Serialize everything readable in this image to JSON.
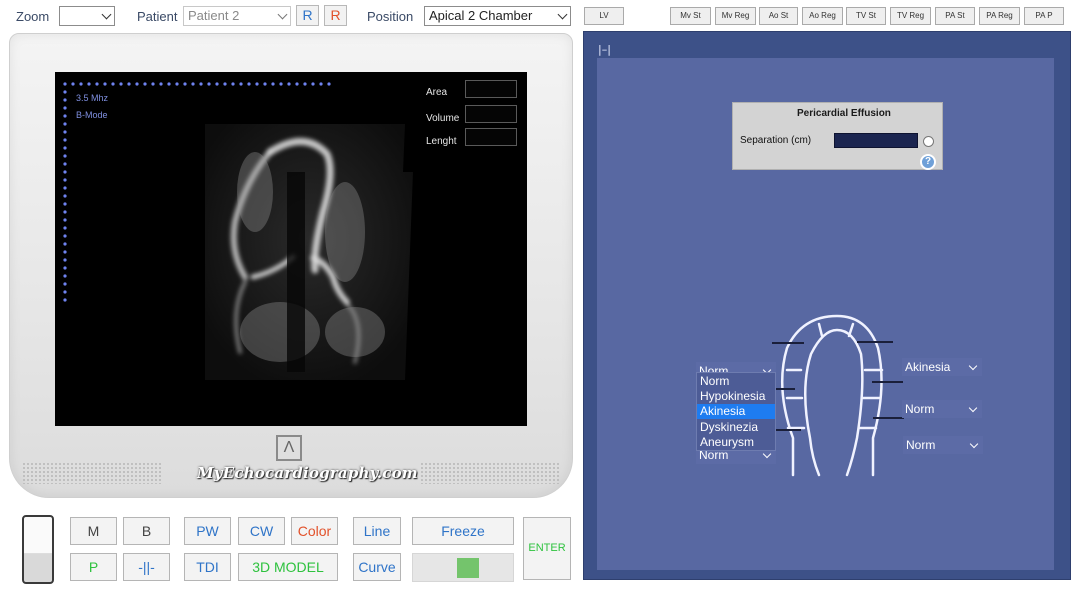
{
  "toolbar": {
    "zoom_label": "Zoom",
    "zoom_value": "",
    "patient_label": "Patient",
    "patient_value": "Patient 2",
    "r_blue": "R",
    "r_red": "R",
    "position_label": "Position",
    "position_value": "Apical 2 Chamber",
    "lv_button": "LV",
    "valve_buttons": [
      "Mv St",
      "Mv Reg",
      "Ao St",
      "Ao Reg",
      "TV St",
      "TV Reg",
      "PA St",
      "PA Reg",
      "PA P"
    ]
  },
  "screen": {
    "frequency": "3.5 Mhz",
    "mode": "B-Mode",
    "measure_labels": [
      "Area",
      "Volume",
      "Lenght"
    ]
  },
  "monitor": {
    "brand": "MyEchocardiography.com",
    "logo_glyph": "Λ"
  },
  "controls": {
    "m": "M",
    "b": "B",
    "pw": "PW",
    "cw": "CW",
    "color": "Color",
    "line": "Line",
    "freeze": "Freeze",
    "p": "P",
    "split": "-||-",
    "tdi": "TDI",
    "model3d": "3D MODEL",
    "curve": "Curve",
    "enter": "ENTER"
  },
  "right_panel": {
    "corner_icon": "|–|",
    "pericardial": {
      "title": "Pericardial Effusion",
      "separation_label": "Separation (cm)",
      "separation_value": "",
      "help_glyph": "?"
    },
    "segment_selects": {
      "left_top": "Norm",
      "left_bottom": "Norm",
      "right_top": "Akinesia",
      "right_mid": "Norm",
      "right_bottom": "Norm"
    },
    "dropdown_options": [
      "Norm",
      "Hypokinesia",
      "Akinesia",
      "Dyskinezia",
      "Aneurysm"
    ],
    "dropdown_selected": "Akinesia"
  },
  "colors": {
    "panel_dark": "#3d5188",
    "panel_light": "#5868a2",
    "highlight": "#1e7cf0",
    "accent_blue": "#2f74c8",
    "accent_green": "#2ec23e",
    "accent_red": "#e2512a"
  }
}
